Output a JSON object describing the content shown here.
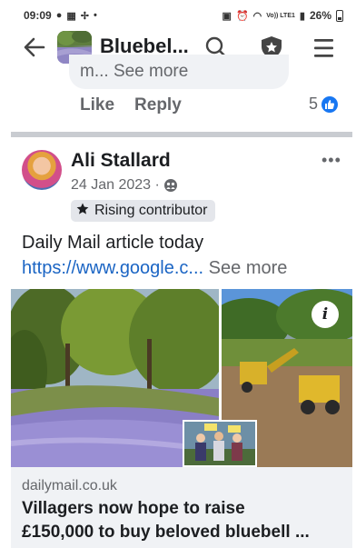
{
  "status_bar": {
    "time": "09:09",
    "network_label": "Vo)) LTE1",
    "battery": "26%"
  },
  "app_bar": {
    "title": "Bluebel..."
  },
  "previous_comment": {
    "text_fragment": "m... See more",
    "like_label": "Like",
    "reply_label": "Reply",
    "reaction_count": "5"
  },
  "post": {
    "author": "Ali Stallard",
    "date": "24 Jan 2023 ·",
    "badge": "Rising contributor",
    "text": "Daily Mail article today",
    "link_text": "https://www.google.c...",
    "see_more": "See more",
    "link_preview": {
      "domain": "dailymail.co.uk",
      "title_line1": "Villagers now hope to raise",
      "title_line2": "£150,000 to buy beloved bluebell ..."
    }
  },
  "colors": {
    "link": "#1b65c4",
    "accent": "#1877f2",
    "muted": "#65676b"
  }
}
